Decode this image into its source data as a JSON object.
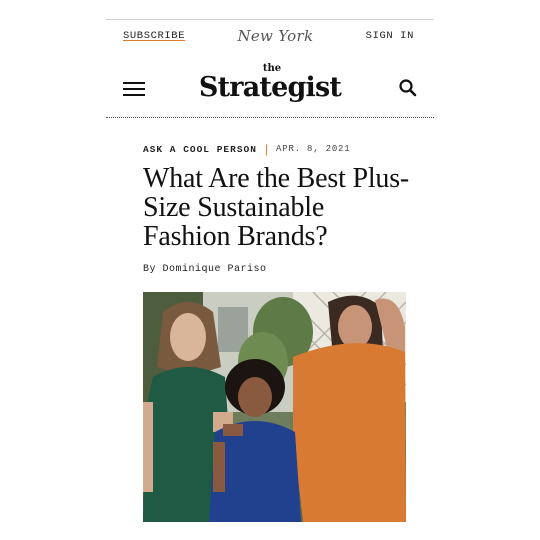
{
  "topbar": {
    "subscribe_label": "SUBSCRIBE",
    "masthead": "New York",
    "signin_label": "SIGN IN"
  },
  "header": {
    "logo_small": "the",
    "logo_big": "Strategist",
    "search_icon": "search-icon",
    "menu_icon": "hamburger-icon"
  },
  "article": {
    "rubric": "ASK A COOL PERSON",
    "separator": "|",
    "date": "APR. 8, 2021",
    "headline": "What Are the Best Plus-Size Sustainable Fashion Brands?",
    "byline": "By Dominique Pariso"
  },
  "colors": {
    "accent": "#e07a2c",
    "green_dress": "#1f5a44",
    "blue_dress": "#21418f",
    "orange_dress": "#d97a33"
  }
}
